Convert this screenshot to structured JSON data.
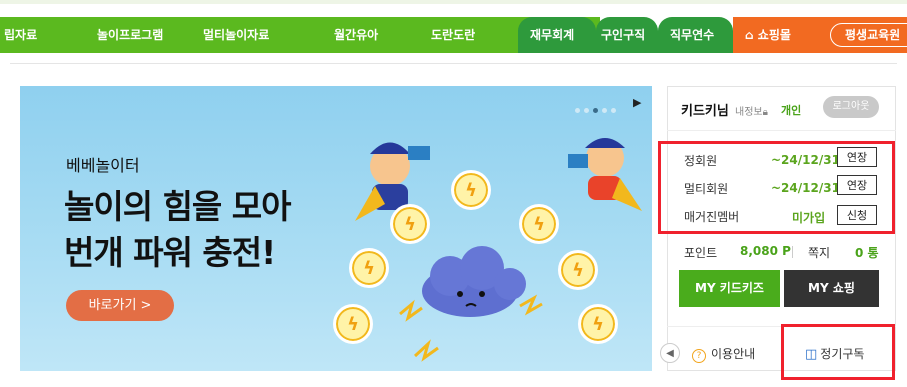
{
  "nav": {
    "items": [
      "립자료",
      "놀이프로그램",
      "멀티놀이자료",
      "월간유아",
      "도란도란"
    ],
    "tabs": [
      "재무회계",
      "구인구직",
      "직무연수"
    ],
    "shop_label": "쇼핑몰",
    "edu_label": "평생교육원",
    "colors": {
      "green": "#5bb91f",
      "dark_green": "#2e9a3c",
      "orange": "#f26a21"
    }
  },
  "banner": {
    "subtitle": "베베놀이터",
    "title_line1": "놀이의 힘을 모아",
    "title_line2": "번개 파워 충전!",
    "button_label": "바로가기 >",
    "slide_count": 5,
    "active_slide": 3
  },
  "panel": {
    "user_name": "키드키님",
    "info_label": "내정보",
    "account_type": "개인",
    "logout_label": "로그아웃",
    "memberships": [
      {
        "label": "정회원",
        "date": "~24/12/31",
        "button": "연장"
      },
      {
        "label": "멀티회원",
        "date": "~24/12/31",
        "button": "연장"
      },
      {
        "label": "매거진멤버",
        "date": "미가입",
        "button": "신청"
      }
    ],
    "point_label": "포인트",
    "point_value": "8,080 P",
    "note_label": "쪽지",
    "note_value": "0 통",
    "my_kidkids": "MY 키드키즈",
    "my_shop": "MY 쇼핑",
    "help_label": "이용안내",
    "subscribe_label": "정기구독",
    "highlight_color": "#f0212d"
  }
}
